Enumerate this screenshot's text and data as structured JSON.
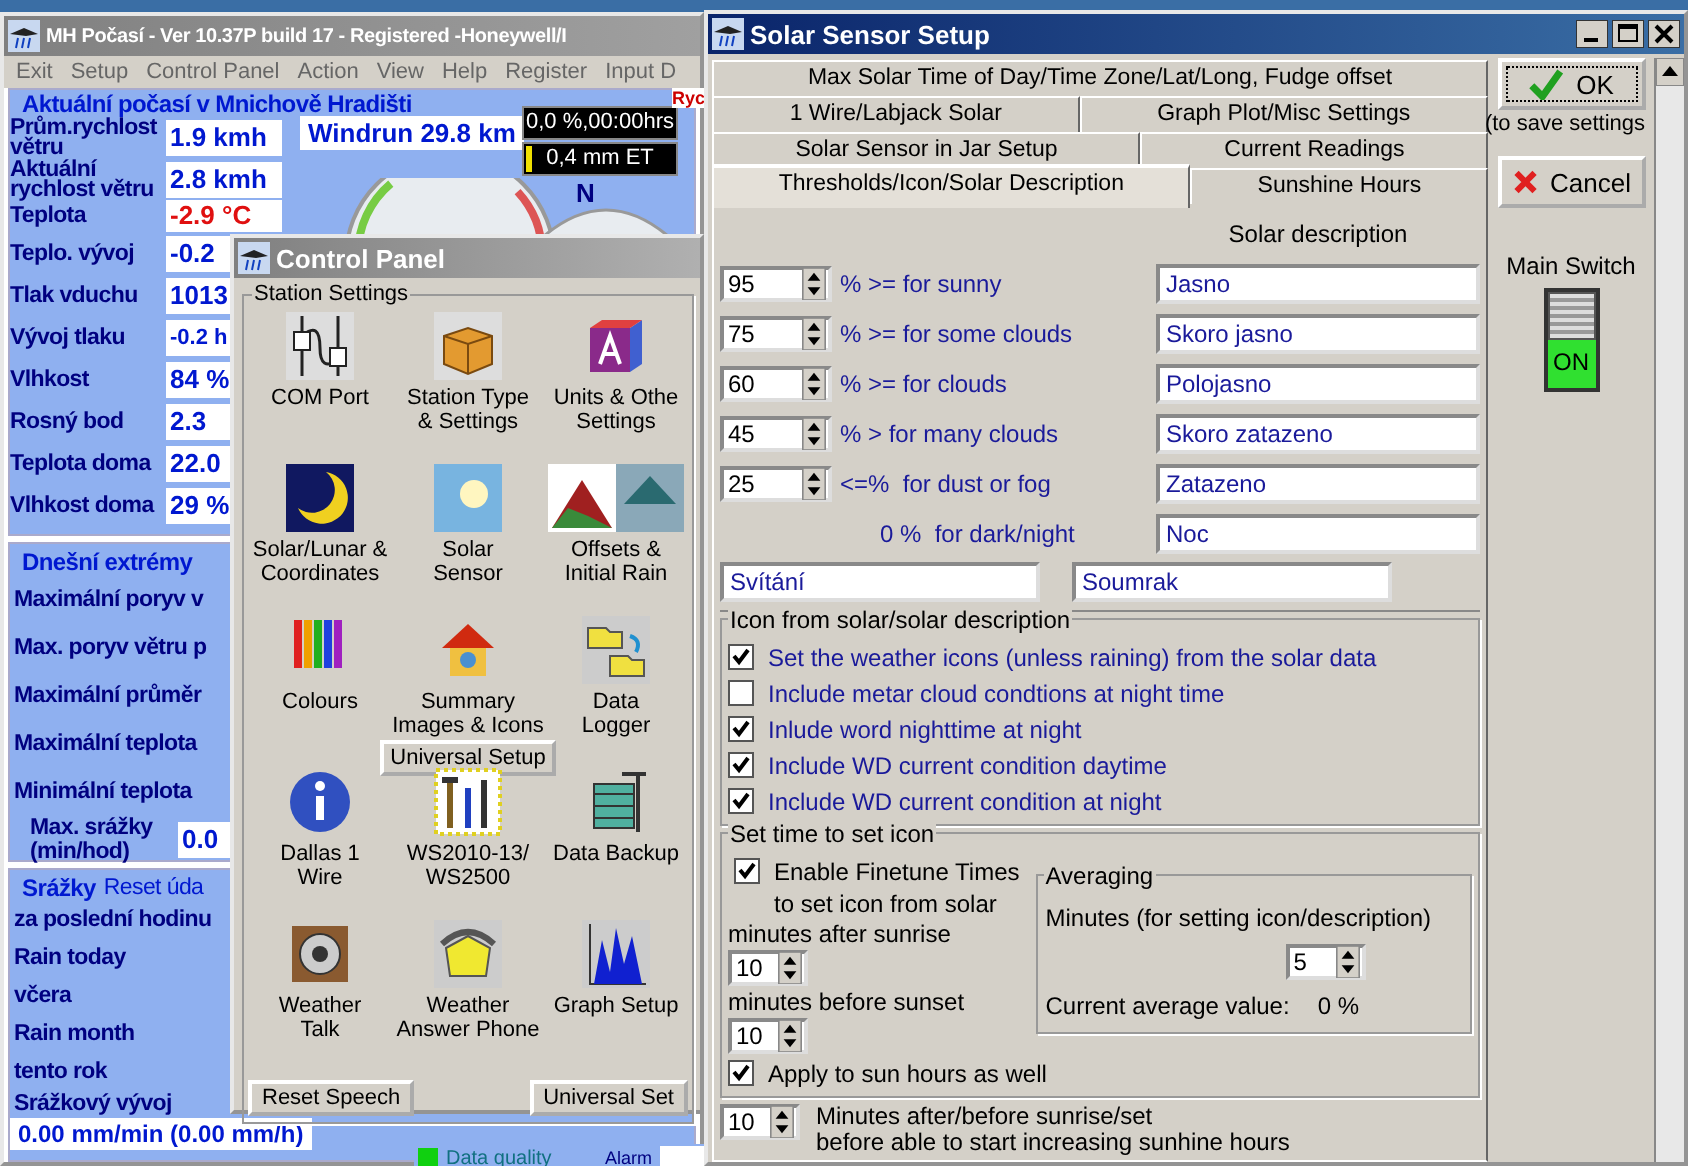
{
  "main_window": {
    "title": "MH Počasí - Ver 10.37P build 17 - Registered  -Honeywell/I",
    "menu": [
      "Exit",
      "Setup",
      "Control Panel",
      "Action",
      "View",
      "Help",
      "Register",
      "Input D"
    ],
    "current": {
      "title": "Aktuální počasí v Mnichově Hradišti",
      "rows": [
        {
          "label": "Prům.rychlost větru",
          "value": "1.9 kmh",
          "alert": false
        },
        {
          "label": "Aktuální rychlost větru",
          "value": "2.8 kmh",
          "alert": false
        },
        {
          "label": "Teplota",
          "value": "-2.9 °C",
          "alert": true
        },
        {
          "label": "Teplo. vývoj",
          "value": "-0.2",
          "alert": false
        },
        {
          "label": "Tlak vduchu",
          "value": "1013",
          "alert": false
        },
        {
          "label": "Vývoj tlaku",
          "value": "-0.2 h",
          "alert": false
        },
        {
          "label": "Vlhkost",
          "value": "84 %",
          "alert": false
        },
        {
          "label": "Rosný bod",
          "value": "2.3",
          "alert": false
        },
        {
          "label": "Teplota doma",
          "value": "22.0",
          "alert": false
        },
        {
          "label": "Vlhkost doma",
          "value": "29 %",
          "alert": false
        }
      ]
    },
    "windrun": "Windrun 29.8 km",
    "sunshine": "0,0 %,00:00hrs",
    "et": "0,4 mm ET",
    "compass_label": "N",
    "side_label": "Ryc",
    "extremes": {
      "title": "Dnešní extrémy",
      "rows": [
        "Maximální poryv v",
        "Max. poryv větru p",
        "Maximální průměr",
        "Maximální teplota",
        "Minimální teplota"
      ],
      "rain_max_label": "Max. srážky (min/hod)",
      "rain_max_value": "0.0"
    },
    "rain": {
      "title": "Srážky",
      "reset": "Reset úda",
      "rows": [
        "za poslední hodinu",
        "Rain today",
        "včera",
        "Rain month",
        "tento rok"
      ],
      "trend_label": "Srážkový vývoj",
      "trend_value": "0.00 mm/min (0.00 mm/h)"
    },
    "status": {
      "quality": "Data quality",
      "alarm": "Alarm"
    }
  },
  "control_panel": {
    "title": "Control Panel",
    "group": "Station Settings",
    "items": [
      {
        "label": "COM Port"
      },
      {
        "label": "Station Type\n& Settings"
      },
      {
        "label": "Units & Othe\nSettings"
      },
      {
        "label": "Solar/Lunar &\nCoordinates"
      },
      {
        "label": "Solar\nSensor"
      },
      {
        "label": "Offsets &\nInitial Rain"
      },
      {
        "label": "Colours"
      },
      {
        "label": "Summary\nImages & Icons",
        "button": "Universal Setup"
      },
      {
        "label": "Data\nLogger"
      },
      {
        "label": "Dallas 1\nWire"
      },
      {
        "label": "WS2010-13/\nWS2500"
      },
      {
        "label": "Data Backup"
      },
      {
        "label": "Weather\nTalk"
      },
      {
        "label": "Weather\nAnswer Phone"
      },
      {
        "label": "Graph Setup"
      }
    ],
    "buttons": [
      "Reset Speech",
      "Universal Set"
    ]
  },
  "solar_window": {
    "title": "Solar Sensor Setup",
    "tab_rows": [
      [
        {
          "label": "Max Solar Time of Day/Time Zone/Lat/Long, Fudge offset",
          "selected": false
        }
      ],
      [
        {
          "label": "1 Wire/Labjack Solar",
          "selected": false
        },
        {
          "label": "Graph Plot/Misc Settings",
          "selected": false
        }
      ],
      [
        {
          "label": "Solar Sensor in Jar Setup",
          "selected": false
        },
        {
          "label": "Current Readings",
          "selected": false
        }
      ],
      [
        {
          "label": "Thresholds/Icon/Solar Description",
          "selected": true
        },
        {
          "label": "Sunshine Hours",
          "selected": false
        }
      ]
    ],
    "description_header": "Solar description",
    "thresholds": [
      {
        "value": "95",
        "label": "% >= for sunny",
        "description": "Jasno"
      },
      {
        "value": "75",
        "label": "% >= for some clouds",
        "description": "Skoro jasno"
      },
      {
        "value": "60",
        "label": "% >= for clouds",
        "description": "Polojasno"
      },
      {
        "value": "45",
        "label": "% > for many clouds",
        "description": "Skoro zatazeno"
      },
      {
        "value": "25",
        "label": "<=%  for dust or fog",
        "description": "Zatazeno"
      }
    ],
    "night": {
      "label": "0 %  for dark/night",
      "description": "Noc"
    },
    "dawn": "Svítání",
    "dusk": "Soumrak",
    "icon_group": {
      "title": "Icon from solar/solar description",
      "options": [
        {
          "label": "Set the weather icons (unless raining) from the solar data",
          "checked": true
        },
        {
          "label": "Include metar cloud condtions at night time",
          "checked": false
        },
        {
          "label": "Inlude word nighttime at night",
          "checked": true
        },
        {
          "label": "Include WD current condition daytime",
          "checked": true
        },
        {
          "label": "Include WD current condition at night",
          "checked": true
        }
      ]
    },
    "time_group": {
      "title": "Set time to set icon",
      "finetune": {
        "label": "Enable Finetune Times",
        "checked": true
      },
      "finetune_note": "to set icon from solar",
      "after_label": "minutes after sunrise",
      "after_value": "10",
      "before_label": "minutes before sunset",
      "before_value": "10",
      "averaging": {
        "title": "Averaging",
        "minutes_label": "Minutes (for setting icon/description)",
        "minutes_value": "5",
        "current_label": "Current average value:",
        "current_value": "0 %"
      },
      "apply": {
        "label": "Apply to sun hours as well",
        "checked": true
      }
    },
    "sunshine_delay": {
      "value": "10",
      "line1": "Minutes after/before sunrise/set",
      "line2": "before able to start increasing sunhine hours"
    },
    "ok": "OK",
    "ok_note": "(to save settings",
    "cancel": "Cancel",
    "switch": {
      "label": "Main Switch",
      "state_text": "ON",
      "on": true
    }
  }
}
